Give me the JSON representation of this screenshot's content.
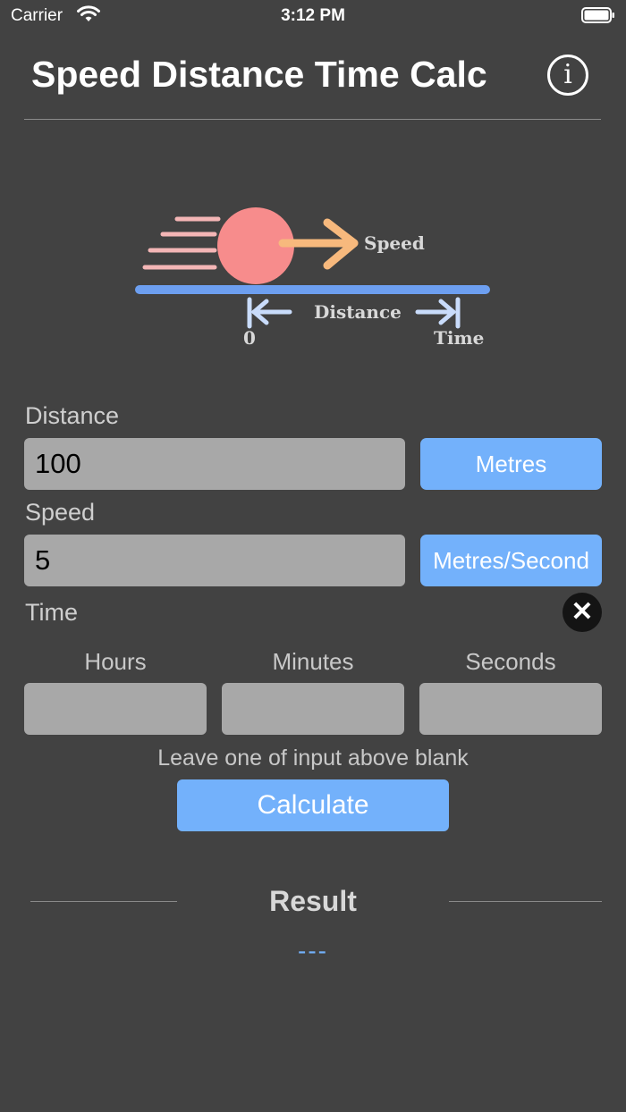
{
  "status_bar": {
    "carrier": "Carrier",
    "time": "3:12 PM"
  },
  "header": {
    "title": "Speed Distance Time Calc",
    "info_glyph": "i"
  },
  "illustration": {
    "speed_label": "Speed",
    "distance_label": "Distance",
    "start_label": "0",
    "time_label": "Time"
  },
  "distance": {
    "label": "Distance",
    "value": "100",
    "unit": "Metres"
  },
  "speed": {
    "label": "Speed",
    "value": "5",
    "unit": "Metres/Second"
  },
  "time": {
    "label": "Time",
    "clear_glyph": "✕",
    "hours_label": "Hours",
    "minutes_label": "Minutes",
    "seconds_label": "Seconds",
    "hours_value": "",
    "minutes_value": "",
    "seconds_value": ""
  },
  "hint": "Leave one of input above blank",
  "calculate_label": "Calculate",
  "result": {
    "title": "Result",
    "value": "---"
  },
  "colors": {
    "background": "#424242",
    "accent": "#73b1fb",
    "input": "#a8a8a8"
  }
}
